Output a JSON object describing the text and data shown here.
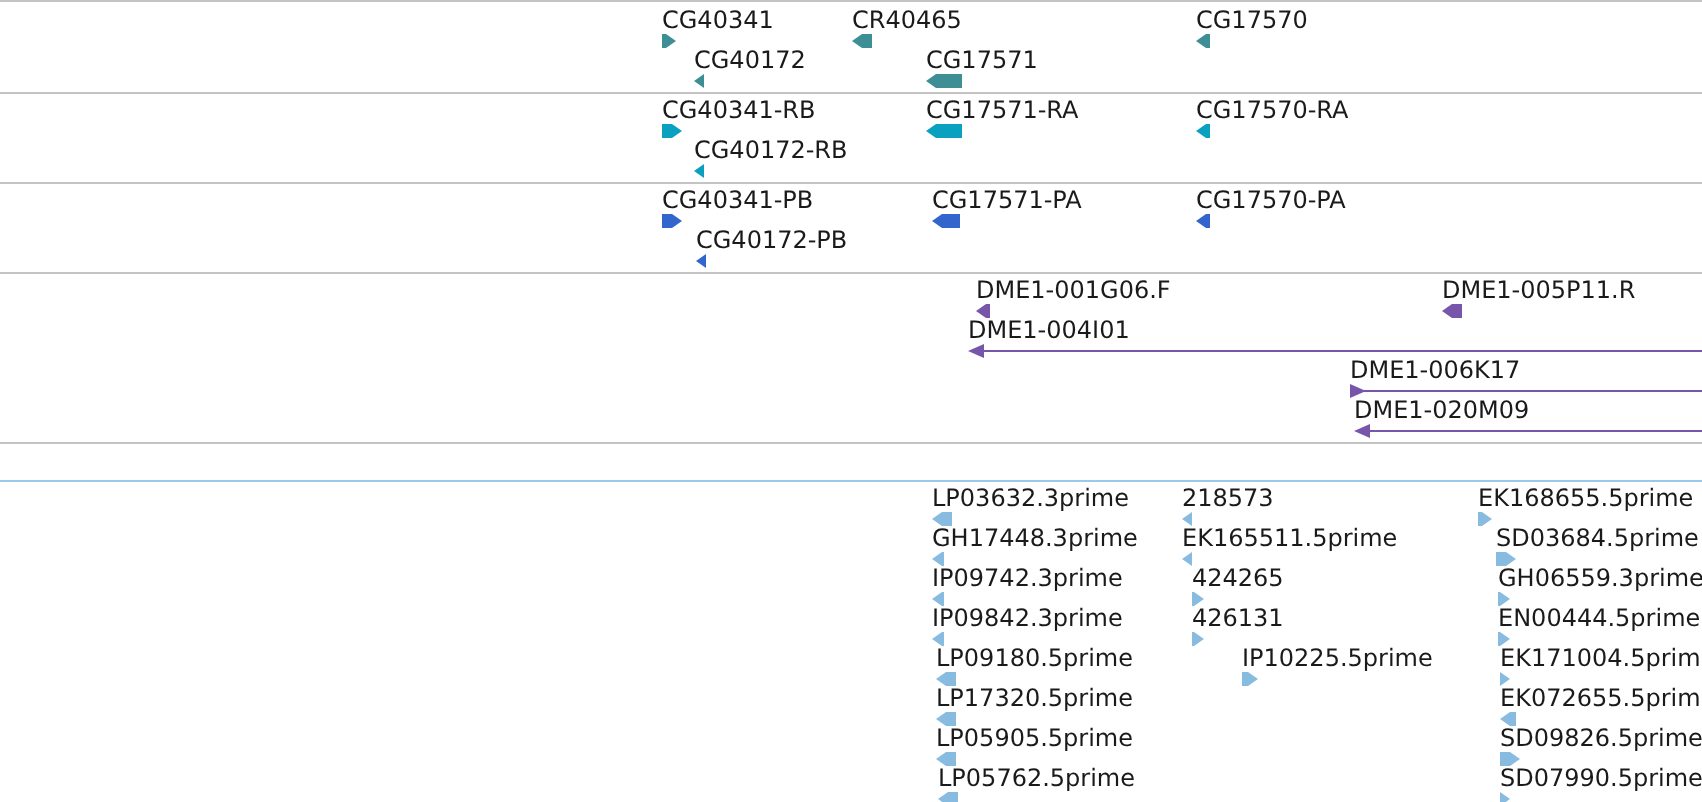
{
  "tracks": [
    {
      "color": "#3e8e96",
      "features": [
        {
          "label": "CG40341",
          "kind": "forward"
        },
        {
          "label": "CR40465",
          "kind": "reverse"
        },
        {
          "label": "CG17570",
          "kind": "reverse"
        },
        {
          "label": "CG40172",
          "kind": "reverse"
        },
        {
          "label": "CG17571",
          "kind": "reverse"
        }
      ]
    },
    {
      "color": "#0aa0c0",
      "features": [
        {
          "label": "CG40341-RB",
          "kind": "forward"
        },
        {
          "label": "CG17571-RA",
          "kind": "reverse"
        },
        {
          "label": "CG17570-RA",
          "kind": "reverse"
        },
        {
          "label": "CG40172-RB",
          "kind": "reverse"
        }
      ]
    },
    {
      "color": "#3366cc",
      "features": [
        {
          "label": "CG40341-PB",
          "kind": "forward"
        },
        {
          "label": "CG17571-PA",
          "kind": "reverse"
        },
        {
          "label": "CG17570-PA",
          "kind": "reverse"
        },
        {
          "label": "CG40172-PB",
          "kind": "reverse"
        }
      ]
    },
    {
      "color": "#7755aa",
      "features": [
        {
          "label": "DME1-001G06.F",
          "kind": "reverse"
        },
        {
          "label": "DME1-005P11.R",
          "kind": "reverse"
        },
        {
          "label": "DME1-004I01",
          "kind": "reverse"
        },
        {
          "label": "DME1-006K17",
          "kind": "forward"
        },
        {
          "label": "DME1-020M09",
          "kind": "reverse"
        }
      ]
    },
    {
      "color": "#88bbe0",
      "features": [
        {
          "label": "LP03632.3prime",
          "kind": "reverse"
        },
        {
          "label": "218573",
          "kind": "reverse"
        },
        {
          "label": "EK168655.5prime",
          "kind": "forward"
        },
        {
          "label": "GH17448.3prime",
          "kind": "reverse"
        },
        {
          "label": "EK165511.5prime",
          "kind": "reverse"
        },
        {
          "label": "SD03684.5prime",
          "kind": "forward"
        },
        {
          "label": "IP09742.3prime",
          "kind": "reverse"
        },
        {
          "label": "424265",
          "kind": "forward"
        },
        {
          "label": "GH06559.3prime",
          "kind": "forward"
        },
        {
          "label": "IP09842.3prime",
          "kind": "reverse"
        },
        {
          "label": "426131",
          "kind": "forward"
        },
        {
          "label": "EN00444.5prime",
          "kind": "forward"
        },
        {
          "label": "LP09180.5prime",
          "kind": "reverse"
        },
        {
          "label": "IP10225.5prime",
          "kind": "forward"
        },
        {
          "label": "EK171004.5prim",
          "kind": "forward"
        },
        {
          "label": "LP17320.5prime",
          "kind": "reverse"
        },
        {
          "label": "EK072655.5prim",
          "kind": "reverse"
        },
        {
          "label": "LP05905.5prime",
          "kind": "reverse"
        },
        {
          "label": "SD09826.5prime",
          "kind": "forward"
        },
        {
          "label": "LP05762.5prime",
          "kind": "reverse"
        },
        {
          "label": "SD07990.5prime",
          "kind": "forward"
        }
      ]
    }
  ]
}
